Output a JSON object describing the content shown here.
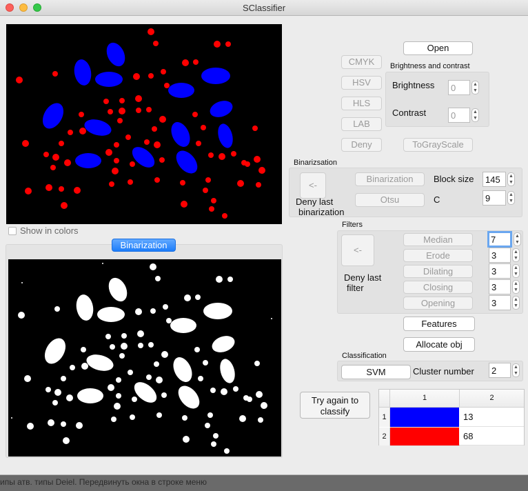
{
  "window": {
    "title": "SClassifier"
  },
  "status_text": "ипы атв. типы Deiel. Передвинуть окна в строке меню",
  "color_buttons": {
    "cmyk": "CMYK",
    "hsv": "HSV",
    "hls": "HLS",
    "lab": "LAB",
    "deny": "Deny",
    "grayscale": "ToGrayScale"
  },
  "open_button": "Open",
  "brightness_contrast": {
    "title": "Brightness and contrast",
    "brightness_label": "Brightness",
    "brightness_value": "0",
    "contrast_label": "Contrast",
    "contrast_value": "0"
  },
  "binarization_group": {
    "title": "Binarizsation",
    "deny_arrow": "<-",
    "deny_label_line1": "Deny last",
    "deny_label_line2": "binarization",
    "binarization_button": "Binarization",
    "otsu_button": "Otsu",
    "block_size_label": "Block size",
    "block_size_value": "145",
    "c_label": "C",
    "c_value": "9"
  },
  "filters_group": {
    "title": "Filters",
    "deny_arrow": "<-",
    "deny_label_line1": "Deny last",
    "deny_label_line2": "filter",
    "rows": [
      {
        "label": "Median",
        "value": "7"
      },
      {
        "label": "Erode",
        "value": "3"
      },
      {
        "label": "Dilating",
        "value": "3"
      },
      {
        "label": "Closing",
        "value": "3"
      },
      {
        "label": "Opening",
        "value": "3"
      }
    ]
  },
  "features_button": "Features",
  "allocate_button": "Allocate obj",
  "classification": {
    "title": "Classification",
    "svm_button": "SVM",
    "cluster_label": "Cluster number",
    "cluster_value": "2"
  },
  "try_again_button": {
    "line1": "Try again to",
    "line2": "classify"
  },
  "results_table": {
    "col_headers": [
      "1",
      "2"
    ],
    "rows": [
      {
        "row": "1",
        "color": "#0000ff",
        "count": "13"
      },
      {
        "row": "2",
        "color": "#ff0000",
        "count": "68"
      }
    ]
  },
  "show_in_colors_label": "Show in colors",
  "binarization_tab": "Binarization",
  "colors": {
    "blue_cells": "#0000ff",
    "red_cells": "#ff0000",
    "accent": "#1d7dfa"
  }
}
